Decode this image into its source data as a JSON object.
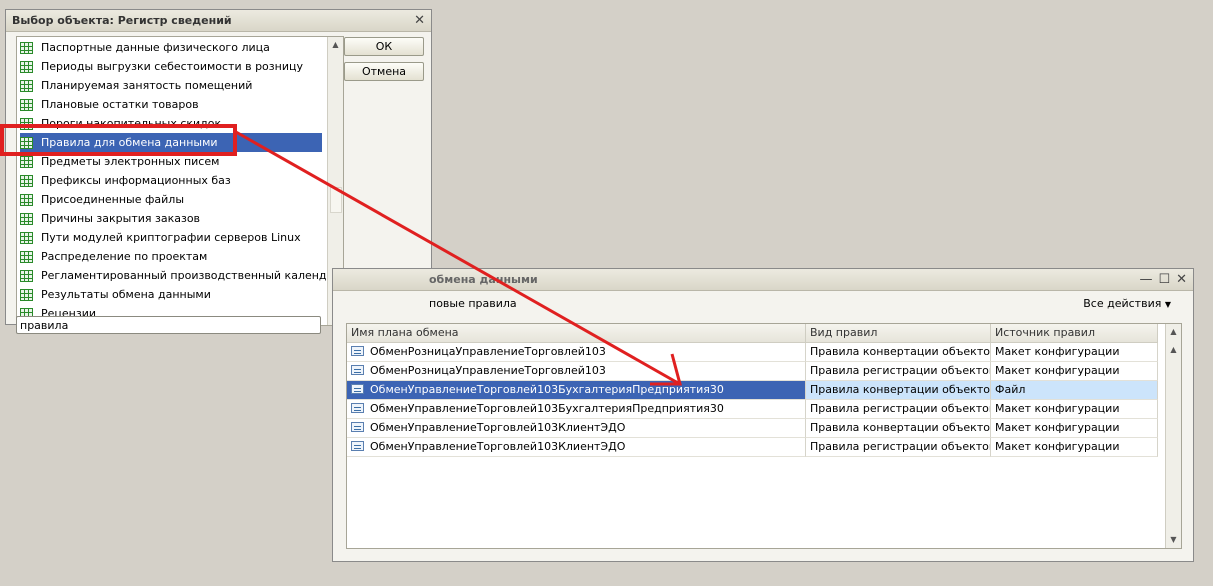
{
  "dialog1": {
    "title": "Выбор объекта: Регистр сведений",
    "close": "✕",
    "ok_label": "ОК",
    "cancel_label": "Отмена",
    "items": [
      "Паспортные данные физического лица",
      "Периоды выгрузки себестоимости в розницу",
      "Планируемая занятость помещений",
      "Плановые остатки товаров",
      "Пороги накопительных скидок",
      "Правила для обмена данными",
      "Предметы электронных писем",
      "Префиксы информационных баз",
      "Присоединенные файлы",
      "Причины закрытия заказов",
      "Пути модулей криптографии серверов Linux",
      "Распределение по проектам",
      "Регламентированный производственный календарь",
      "Результаты обмена данными",
      "Рецензии"
    ],
    "selected_index": 5,
    "search_value": "правила"
  },
  "dialog2": {
    "title": "обмена данными",
    "minimize": "—",
    "maximize": "☐",
    "close": "✕",
    "command_text": "повые правила",
    "all_actions_label": "Все действия",
    "columns": [
      "Имя плана обмена",
      "Вид правил",
      "Источник правил"
    ],
    "rows": [
      [
        "ОбменРозницаУправлениеТорговлей103",
        "Правила конвертации объектов",
        "Макет конфигурации"
      ],
      [
        "ОбменРозницаУправлениеТорговлей103",
        "Правила регистрации объектов",
        "Макет конфигурации"
      ],
      [
        "ОбменУправлениеТорговлей103БухгалтерияПредприятия30",
        "Правила конвертации объектов",
        "Файл"
      ],
      [
        "ОбменУправлениеТорговлей103БухгалтерияПредприятия30",
        "Правила регистрации объектов",
        "Макет конфигурации"
      ],
      [
        "ОбменУправлениеТорговлей103КлиентЭДО",
        "Правила конвертации объектов",
        "Макет конфигурации"
      ],
      [
        "ОбменУправлениеТорговлей103КлиентЭДО",
        "Правила регистрации объектов",
        "Макет конфигурации"
      ]
    ],
    "selected_index": 2
  },
  "annotation": {
    "color": "#e02020"
  },
  "icons": {
    "list_item": "table-grid-icon",
    "row_item": "exchange-plan-icon"
  },
  "colors": {
    "selection": "#3c64b4",
    "row_selection": "#cce4fb"
  }
}
